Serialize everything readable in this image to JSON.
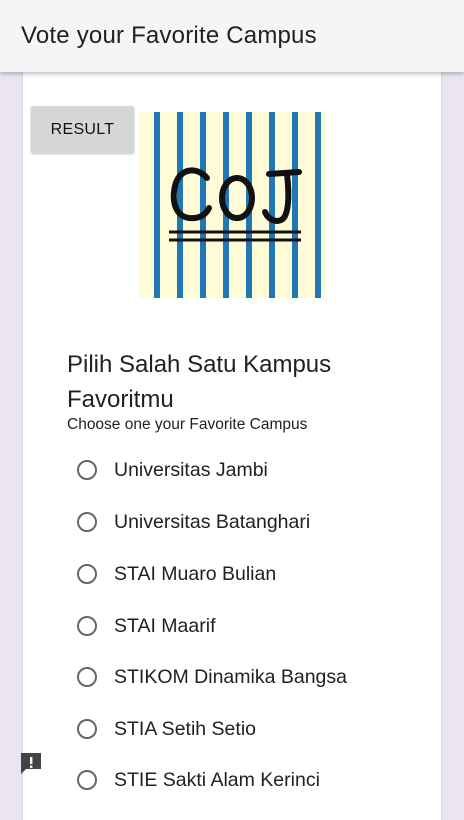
{
  "appbar": {
    "title": "Vote your Favorite Campus"
  },
  "result_button": {
    "label": "RESULT"
  },
  "logo": {
    "text": "COJ"
  },
  "form": {
    "question": "Pilih Salah Satu Kampus Favoritmu",
    "subtitle": "Choose one your Favorite Campus",
    "options": [
      "Universitas Jambi",
      "Universitas Batanghari",
      "STAI Muaro Bulian",
      "STAI Maarif",
      "STIKOM Dinamika Bangsa",
      "STIA Setih Setio",
      "STIE Sakti Alam Kerinci"
    ]
  },
  "feedback": {
    "icon": "feedback-icon"
  }
}
